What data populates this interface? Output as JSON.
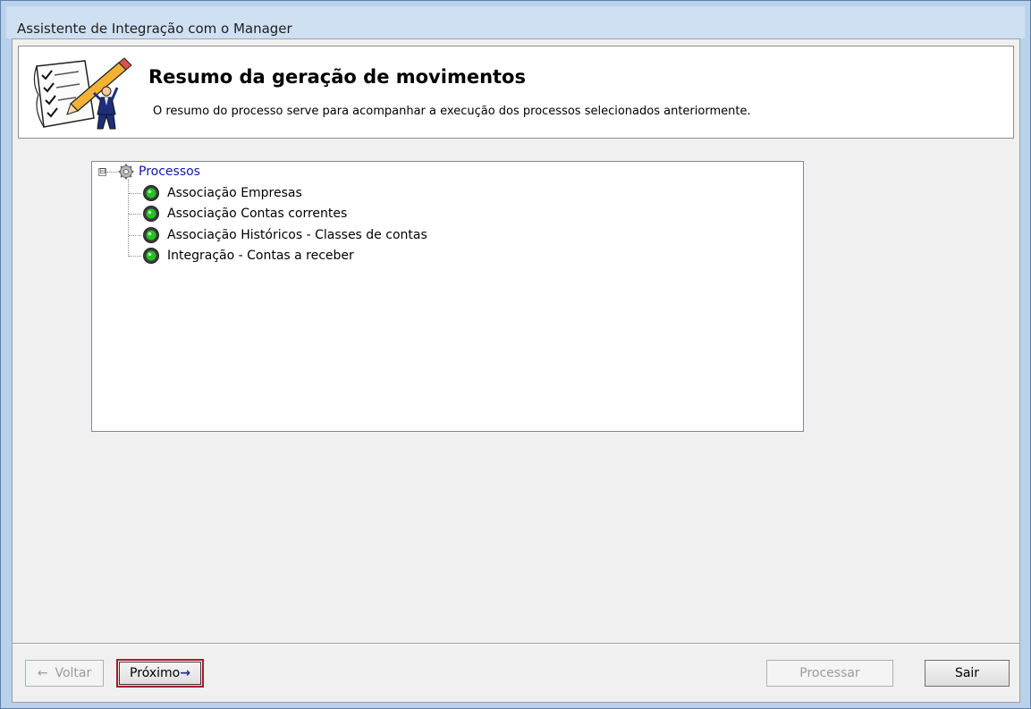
{
  "window": {
    "title": "Assistente de Integração com o Manager"
  },
  "header": {
    "title": "Resumo da geração de movimentos",
    "description": "O resumo do processo serve para acompanhar a execução dos processos selecionados anteriormente."
  },
  "tree": {
    "root": {
      "label": "Processos",
      "expander": "⊟",
      "icon": "gear-icon"
    },
    "items": [
      {
        "label": "Associação Empresas",
        "icon": "green-status-icon"
      },
      {
        "label": "Associação Contas correntes",
        "icon": "green-status-icon"
      },
      {
        "label": "Associação Históricos - Classes de contas",
        "icon": "green-status-icon"
      },
      {
        "label": "Integração - Contas a receber",
        "icon": "green-status-icon"
      }
    ]
  },
  "buttons": {
    "back": "Voltar",
    "back_arrow": "←",
    "next": "Próximo",
    "next_arrow": "→",
    "process": "Processar",
    "exit": "Sair"
  },
  "colors": {
    "root_label": "#1515a8",
    "status_green": "#22c322",
    "focus_border": "#a0202a"
  }
}
